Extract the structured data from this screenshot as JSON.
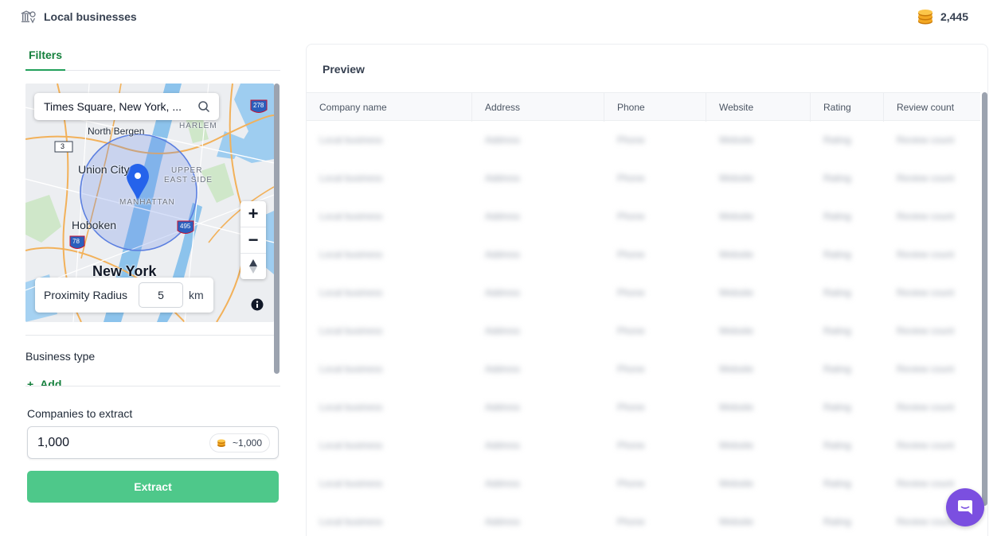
{
  "header": {
    "title": "Local businesses",
    "credits": "2,445"
  },
  "tabs": {
    "filters": "Filters"
  },
  "map": {
    "search_value": "Times Square, New York, ...",
    "labels": {
      "north_bergen": "North Bergen",
      "harlem": "HARLEM",
      "union_city": "Union City",
      "upper": "UPPER",
      "east_side": "EAST SIDE",
      "manhattan": "MANHATTAN",
      "hoboken": "Hoboken",
      "new_york": "New York"
    },
    "shields": {
      "rt3": "3",
      "i278": "278",
      "i495": "495",
      "rt78": "78"
    },
    "zoom_in": "+",
    "zoom_out": "−",
    "radius_label": "Proximity Radius",
    "radius_value": "5",
    "radius_unit": "km"
  },
  "filters": {
    "business_type_label": "Business type",
    "add_label": "Add",
    "add_icon": "+"
  },
  "extract": {
    "companies_label": "Companies to extract",
    "companies_value": "1,000",
    "cost_estimate": "~1,000",
    "button_label": "Extract"
  },
  "preview": {
    "title": "Preview",
    "columns": [
      "Company name",
      "Address",
      "Phone",
      "Website",
      "Rating",
      "Review count"
    ],
    "placeholder_row": [
      "Local business",
      "Address",
      "Phone",
      "Website",
      "Rating",
      "Review count"
    ],
    "row_count": 11
  },
  "colors": {
    "accent": "#15803d",
    "button": "#4ec88a",
    "chat": "#7b4fe0"
  }
}
